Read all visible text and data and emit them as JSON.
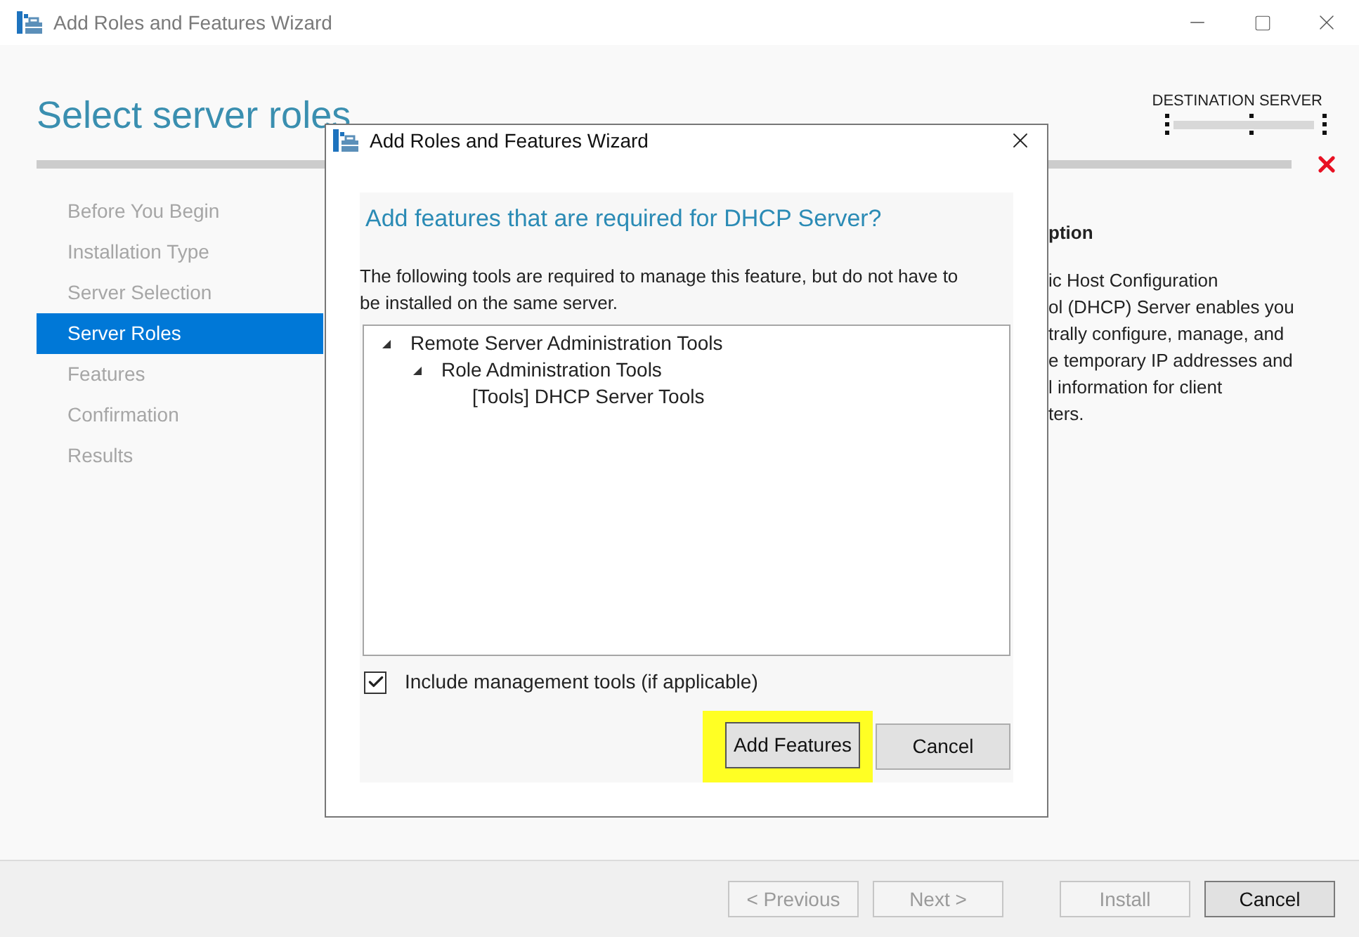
{
  "window": {
    "title": "Add Roles and Features Wizard"
  },
  "page": {
    "heading": "Select server roles",
    "destination_label": "DESTINATION SERVER"
  },
  "steps": [
    {
      "label": "Before You Begin",
      "selected": false
    },
    {
      "label": "Installation Type",
      "selected": false
    },
    {
      "label": "Server Selection",
      "selected": false
    },
    {
      "label": "Server Roles",
      "selected": true
    },
    {
      "label": "Features",
      "selected": false
    },
    {
      "label": "Confirmation",
      "selected": false
    },
    {
      "label": "Results",
      "selected": false
    }
  ],
  "description": {
    "heading": "ption",
    "lines": [
      "ic Host Configuration",
      "ol (DHCP) Server enables you",
      "trally configure, manage, and",
      "e temporary IP addresses and",
      "l information for client",
      "ters."
    ]
  },
  "footer_buttons": [
    {
      "label": "< Previous",
      "disabled": true
    },
    {
      "label": "Next >",
      "disabled": true
    },
    {
      "label": "Install",
      "disabled": true
    },
    {
      "label": "Cancel",
      "disabled": false
    }
  ],
  "dialog": {
    "title": "Add Roles and Features Wizard",
    "heading": "Add features that are required for DHCP Server?",
    "message": "The following tools are required to manage this feature, but do not have to be installed on the same server.",
    "tree": [
      {
        "label": "Remote Server Administration Tools",
        "expanded": true,
        "children": [
          {
            "label": "Role Administration Tools",
            "expanded": true,
            "children": [
              {
                "label": "[Tools] DHCP Server Tools"
              }
            ]
          }
        ]
      }
    ],
    "include_tools": {
      "label": "Include management tools (if applicable)",
      "checked": true
    },
    "buttons": [
      {
        "label": "Add Features",
        "highlighted": true
      },
      {
        "label": "Cancel",
        "highlighted": false
      }
    ]
  }
}
